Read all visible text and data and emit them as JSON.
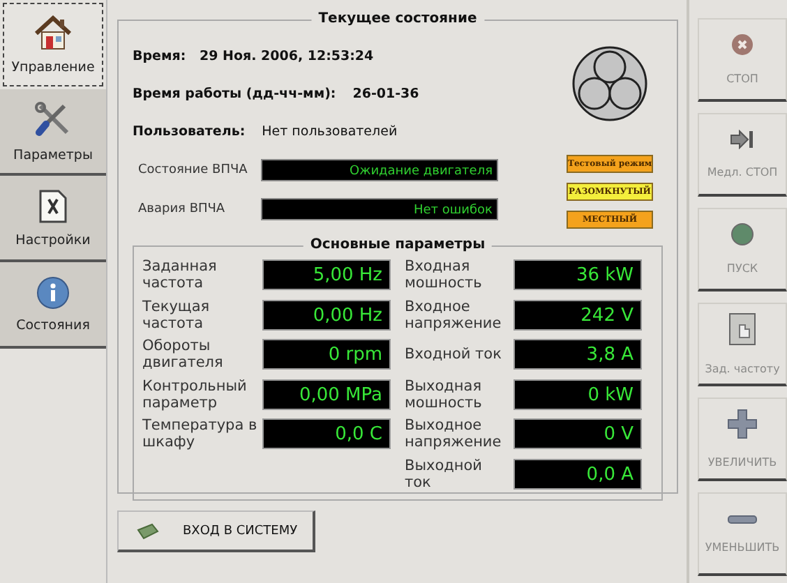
{
  "sidebar": {
    "tabs": [
      {
        "label": "Управление",
        "kind": "home",
        "selected": true
      },
      {
        "label": "Параметры",
        "kind": "tools",
        "selected": false
      },
      {
        "label": "Настройки",
        "kind": "settings",
        "selected": false
      },
      {
        "label": "Состояния",
        "kind": "info",
        "selected": false
      }
    ]
  },
  "status": {
    "title": "Текущее состояние",
    "time_label": "Время:",
    "time": "29 Ноя. 2006, 12:53:24",
    "uptime_label": "Время работы (дд-чч-мм):",
    "uptime": "26-01-36",
    "user_label": "Пользователь:",
    "user": "Нет пользователей",
    "displays": [
      {
        "label": "Состояние ВПЧА",
        "value": "Ожидание двигателя"
      },
      {
        "label": "Авария ВПЧА",
        "value": "Нет ошибок"
      }
    ],
    "indicators": [
      {
        "label": "Тестовый режим",
        "color": "#f4a21c"
      },
      {
        "label": "РАЗОМКНУТЫЙ",
        "color": "#f4ee3c"
      },
      {
        "label": "МЕСТНЫЙ",
        "color": "#f4a21c"
      }
    ]
  },
  "params": {
    "title": "Основные параметры",
    "left": [
      {
        "label": "Заданная частота",
        "value": "5,00 Hz"
      },
      {
        "label": "Текущая частота",
        "value": "0,00 Hz"
      },
      {
        "label": "Обороты двигателя",
        "value": "0 rpm"
      },
      {
        "label": "Контрольный параметр",
        "value": "0,00 MPa"
      },
      {
        "label": "Температура в шкафу",
        "value": "0,0 C"
      }
    ],
    "right": [
      {
        "label": "Входная мошность",
        "value": "36 kW"
      },
      {
        "label": "Входное напряжение",
        "value": "242 V"
      },
      {
        "label": "Входной ток",
        "value": "3,8 A"
      },
      {
        "label": "Выходная мошность",
        "value": "0 kW"
      },
      {
        "label": "Выходное напряжение",
        "value": "0 V"
      },
      {
        "label": "Выходной ток",
        "value": "0,0 A"
      }
    ]
  },
  "login_button": {
    "label": "ВХОД В СИСТЕМУ"
  },
  "commands": [
    {
      "label": "СТОП",
      "kind": "stop",
      "disabled": true
    },
    {
      "label": "Медл. СТОП",
      "kind": "slow-stop",
      "disabled": true
    },
    {
      "label": "ПУСК",
      "kind": "start",
      "disabled": true
    },
    {
      "label": "Зад. частоту",
      "kind": "set-freq",
      "disabled": true
    },
    {
      "label": "УВЕЛИЧИТЬ",
      "kind": "increase",
      "disabled": true
    },
    {
      "label": "УМЕНЬШИТЬ",
      "kind": "decrease",
      "disabled": true
    }
  ]
}
